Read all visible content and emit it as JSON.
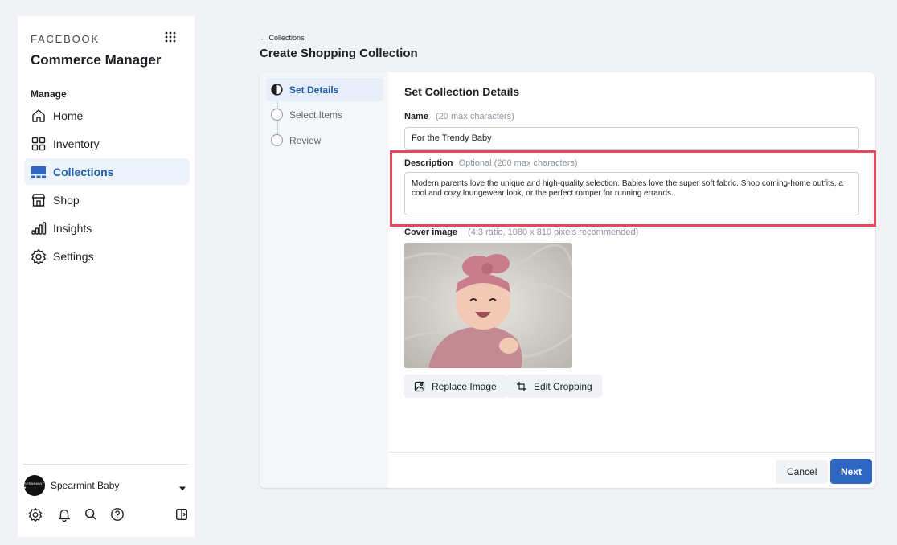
{
  "sidebar": {
    "brand": "FACEBOOK",
    "app_title": "Commerce Manager",
    "section_label": "Manage",
    "items": [
      {
        "label": "Home",
        "icon": "home-icon"
      },
      {
        "label": "Inventory",
        "icon": "inventory-icon"
      },
      {
        "label": "Collections",
        "icon": "collections-icon",
        "active": true
      },
      {
        "label": "Shop",
        "icon": "shop-icon"
      },
      {
        "label": "Insights",
        "icon": "insights-icon"
      },
      {
        "label": "Settings",
        "icon": "settings-icon"
      }
    ],
    "account": {
      "name": "Spearmint Baby",
      "avatar_text": "SPEARMINT ♥"
    },
    "bottom_icons": [
      "settings-gear-icon",
      "notifications-bell-icon",
      "search-icon",
      "help-icon",
      "panel-toggle-icon"
    ]
  },
  "header": {
    "breadcrumb": "← Collections",
    "title": "Create Shopping Collection"
  },
  "steps": [
    {
      "label": "Set Details",
      "active": true
    },
    {
      "label": "Select Items",
      "active": false
    },
    {
      "label": "Review",
      "active": false
    }
  ],
  "form": {
    "title": "Set Collection Details",
    "name_label": "Name",
    "name_hint": "(20 max characters)",
    "name_value": "For the Trendy Baby",
    "description_label": "Description",
    "description_hint": "Optional (200 max characters)",
    "description_value": "Modern parents love the unique and high-quality selection. Babies love the super soft fabric. Shop coming-home outfits, a cool and cozy loungewear look, or the perfect romper for running errands.",
    "cover_label": "Cover image",
    "cover_hint": "(4:3 ratio, 1080 x 810 pixels recommended)",
    "replace_label": "Replace Image",
    "crop_label": "Edit Cropping"
  },
  "footer": {
    "cancel_label": "Cancel",
    "next_label": "Next"
  },
  "colors": {
    "accent": "#2f66c2",
    "active_nav": "#1e5fa8",
    "highlight": "#e8465a",
    "background": "#f0f2f5"
  }
}
